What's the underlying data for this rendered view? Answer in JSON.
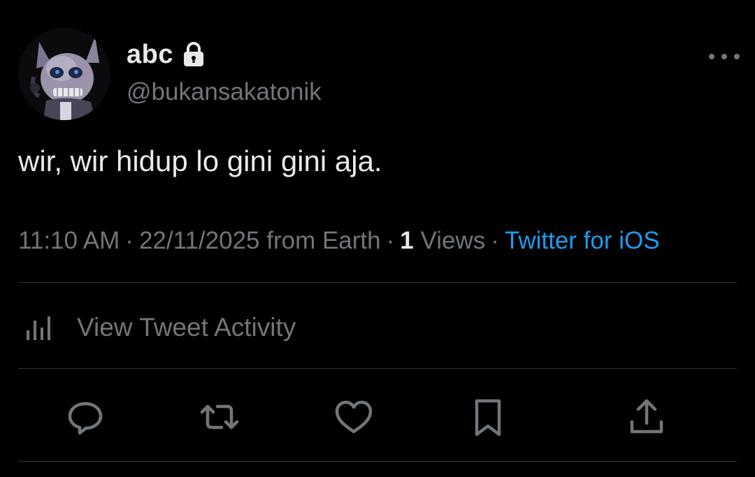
{
  "colors": {
    "background": "#000000",
    "primary_text": "#e7e9ea",
    "secondary_text": "#71767b",
    "accent": "#1d9bf0",
    "divider": "#2f3336"
  },
  "author": {
    "display_name": "abc",
    "handle": "@bukansakatonik",
    "protected_icon": "lock-icon",
    "avatar_icon": "avatar"
  },
  "tweet": {
    "text": "wir, wir hidup lo gini gini aja."
  },
  "meta": {
    "time": "11:10 AM",
    "separator": "·",
    "date_location": "22/11/2025 from Earth",
    "views_count": "1",
    "views_label": "Views",
    "source": "Twitter for iOS"
  },
  "activity": {
    "label": "View Tweet Activity",
    "icon": "bar-chart-icon"
  },
  "actions": [
    {
      "name": "reply",
      "icon": "reply-icon"
    },
    {
      "name": "retweet",
      "icon": "retweet-icon"
    },
    {
      "name": "like",
      "icon": "heart-icon"
    },
    {
      "name": "bookmark",
      "icon": "bookmark-icon"
    },
    {
      "name": "share",
      "icon": "share-icon"
    }
  ],
  "more_icon": "more-icon"
}
